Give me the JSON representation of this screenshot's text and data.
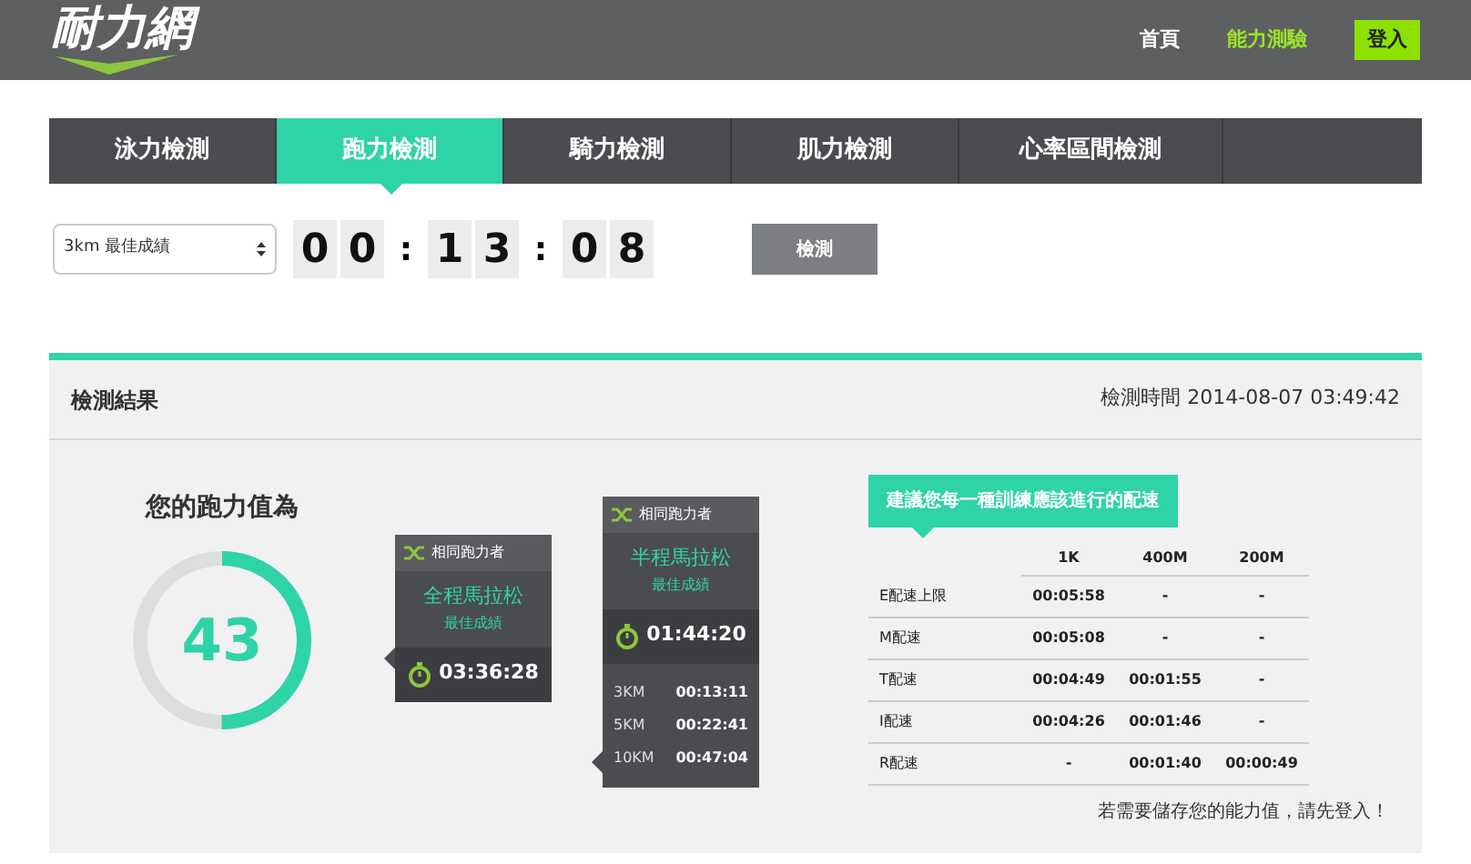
{
  "header": {
    "logo": "耐力網",
    "nav": [
      {
        "label": "首頁",
        "selected": false
      },
      {
        "label": "能力測驗",
        "selected": true
      }
    ],
    "login": "登入"
  },
  "tabs": [
    {
      "label": "泳力檢測",
      "selected": false
    },
    {
      "label": "跑力檢測",
      "selected": true
    },
    {
      "label": "騎力檢測",
      "selected": false
    },
    {
      "label": "肌力檢測",
      "selected": false
    },
    {
      "label": "心率區間檢測",
      "selected": false
    }
  ],
  "form": {
    "select": "3km 最佳成績",
    "time_fields": [
      {
        "digits": [
          "0",
          "0"
        ]
      },
      {
        "digits": [
          "1",
          "3"
        ]
      },
      {
        "digits": [
          "0",
          "8"
        ]
      }
    ],
    "separators": [
      ":",
      ":"
    ],
    "button": "檢測"
  },
  "result": {
    "title": "檢測結果",
    "time": "檢測時間 2014-08-07 03:49:42",
    "score_title": "您的跑力值為",
    "score": "43",
    "level": 0.5,
    "cards": [
      {
        "header": "相同跑力者",
        "event": "全程馬拉松",
        "subtitle": "最佳成績",
        "time": "03:36:28"
      },
      {
        "header": "相同跑力者",
        "event": "半程馬拉松",
        "subtitle": "最佳成績",
        "time": "01:44:20",
        "splits": [
          {
            "distance": "3KM",
            "time": "00:13:11"
          },
          {
            "distance": "5KM",
            "time": "00:22:41"
          },
          {
            "distance": "10KM",
            "time": "00:47:04"
          }
        ]
      }
    ],
    "pace_title": "建議您每一種訓練應該進行的配速",
    "pace_table": {
      "columns": [
        "1K",
        "400M",
        "200M"
      ],
      "rows": [
        {
          "name": "E配速上限",
          "cells": [
            "00:05:58",
            "-",
            "-"
          ]
        },
        {
          "name": "M配速",
          "cells": [
            "00:05:08",
            "-",
            "-"
          ]
        },
        {
          "name": "T配速",
          "cells": [
            "00:04:49",
            "00:01:55",
            "-"
          ]
        },
        {
          "name": "I配速",
          "cells": [
            "00:04:26",
            "00:01:46",
            "-"
          ]
        },
        {
          "name": "R配速",
          "cells": [
            "-",
            "00:01:40",
            "00:00:49"
          ]
        }
      ]
    },
    "note": "若需要儲存您的能力值，請先登入！"
  }
}
